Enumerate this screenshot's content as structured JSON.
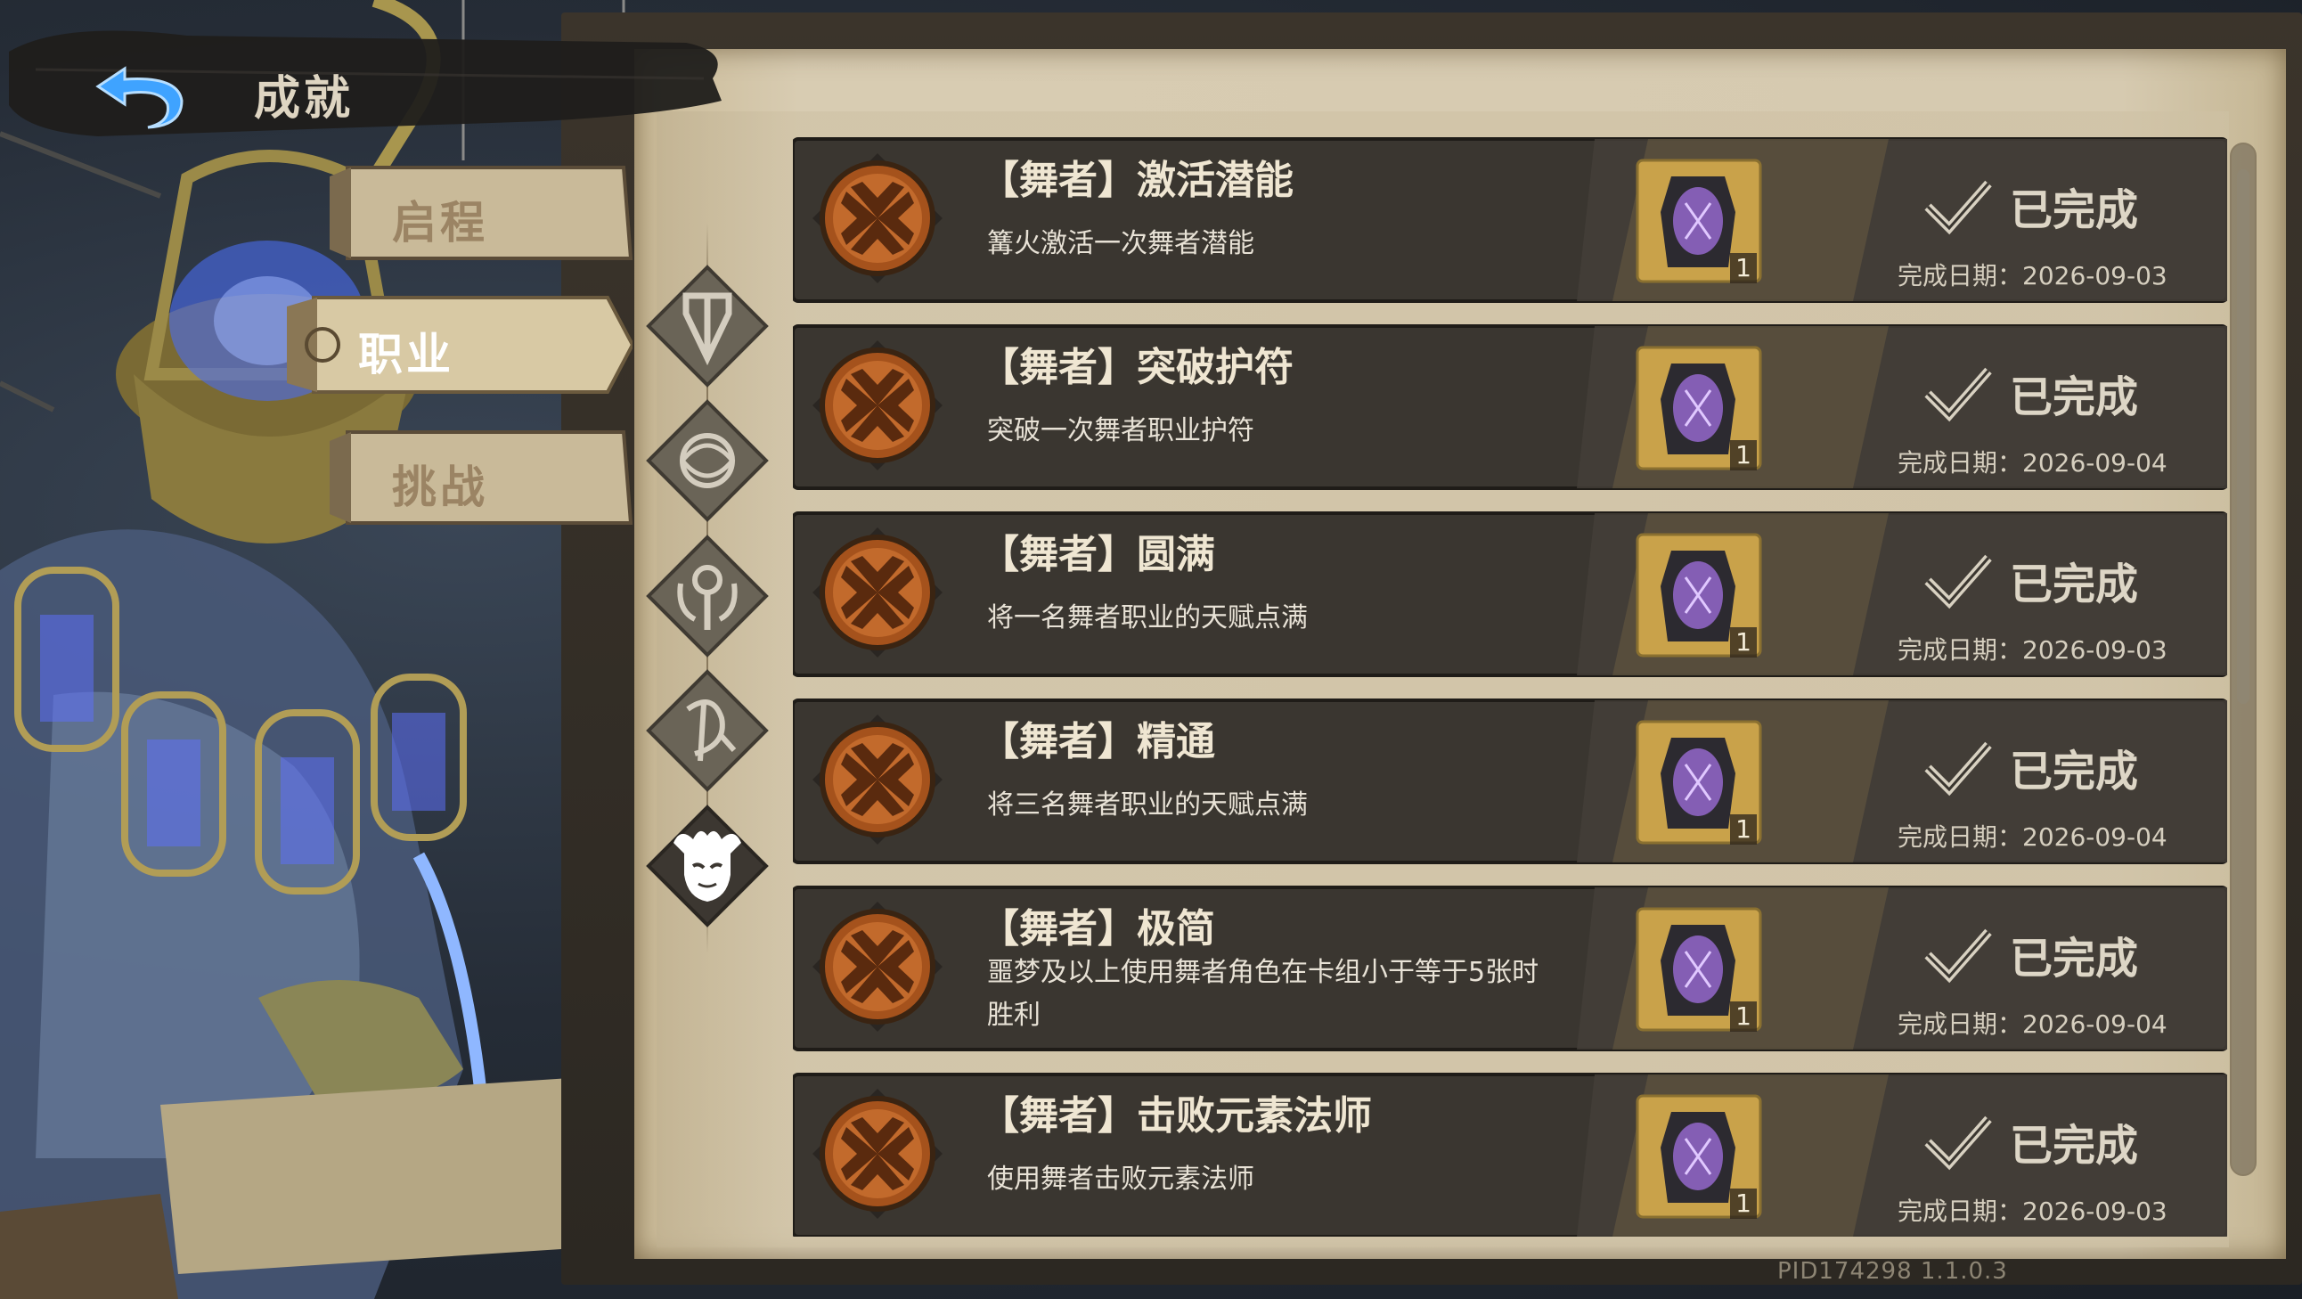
{
  "header": {
    "title": "成就"
  },
  "tabs": [
    {
      "label": "启程",
      "selected": false
    },
    {
      "label": "职业",
      "selected": true
    },
    {
      "label": "挑战",
      "selected": false
    }
  ],
  "class_icons": [
    {
      "icon": "warrior-crest-icon",
      "selected": false
    },
    {
      "icon": "ornate-knot-icon",
      "selected": false
    },
    {
      "icon": "arcane-key-icon",
      "selected": false
    },
    {
      "icon": "rune-sigil-icon",
      "selected": false
    },
    {
      "icon": "jester-mask-icon",
      "selected": true
    }
  ],
  "achievements": [
    {
      "title": "【舞者】激活潜能",
      "desc": "篝火激活一次舞者潜能",
      "reward_count": "1",
      "status": "已完成",
      "date": "完成日期：2026-09-03"
    },
    {
      "title": "【舞者】突破护符",
      "desc": "突破一次舞者职业护符",
      "reward_count": "1",
      "status": "已完成",
      "date": "完成日期：2026-09-04"
    },
    {
      "title": "【舞者】圆满",
      "desc": "将一名舞者职业的天赋点满",
      "reward_count": "1",
      "status": "已完成",
      "date": "完成日期：2026-09-03"
    },
    {
      "title": "【舞者】精通",
      "desc": "将三名舞者职业的天赋点满",
      "reward_count": "1",
      "status": "已完成",
      "date": "完成日期：2026-09-04"
    },
    {
      "title": "【舞者】极简",
      "desc": "噩梦及以上使用舞者角色在卡组小于等于5张时胜利",
      "reward_count": "1",
      "status": "已完成",
      "date": "完成日期：2026-09-04"
    },
    {
      "title": "【舞者】击败元素法师",
      "desc": "使用舞者击败元素法师",
      "reward_count": "1",
      "status": "已完成",
      "date": "完成日期：2026-09-03"
    }
  ],
  "footer": {
    "version": "PID174298  1.1.0.3"
  },
  "colors": {
    "accent_gold": "#c9a24a",
    "medal_bronze": "#a5521c",
    "reward_purple": "#9b6bd6",
    "panel_parchment": "#d6cab0"
  }
}
